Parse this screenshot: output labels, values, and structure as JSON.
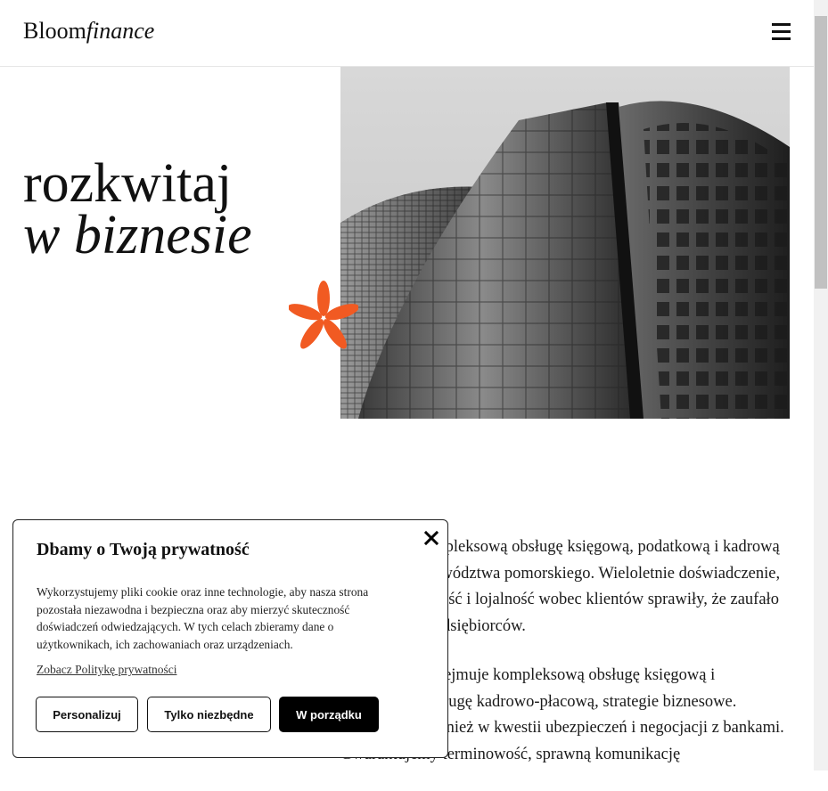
{
  "header": {
    "logo_main": "Bloom",
    "logo_italic": "finance",
    "menu_icon": "hamburger-menu-icon"
  },
  "hero": {
    "title_line1": "rozkwitaj",
    "title_line2": "w biznesie",
    "image_alt": "skyscrapers",
    "accent_color": "#f15a22"
  },
  "content": {
    "paragraph1": "Oferujemy kompleksową obsługę księgową, podatkową i kadrową dla firm z województwa pomorskiego. Wieloletnie doświadczenie, wiedza, rzetelność i lojalność wobec klientów sprawiły, że zaufało nam wielu przedsiębiorców.",
    "paragraph2": "Nasza oferta obejmuje kompleksową obsługę księgową i podatkową, obsługę kadrowo-płacową, strategie biznesowe. Wspieramy również w kwestii ubezpieczeń i negocjacji z bankami. Gwarantujemy terminowość, sprawną komunikację"
  },
  "cookie": {
    "title": "Dbamy o Twoją prywatność",
    "description": "Wykorzystujemy pliki cookie oraz inne technologie, aby nasza strona pozostała niezawodna i bezpieczna oraz aby mierzyć skuteczność doświadczeń odwiedzających. W tych celach zbieramy dane o użytkownikach, ich zachowaniach oraz urządzeniach.",
    "policy_link": "Zobacz Politykę prywatności",
    "btn_personalize": "Personalizuj",
    "btn_necessary": "Tylko niezbędne",
    "btn_accept": "W porządku"
  },
  "colors": {
    "accent": "#f15a22",
    "primary_button": "#000000"
  }
}
